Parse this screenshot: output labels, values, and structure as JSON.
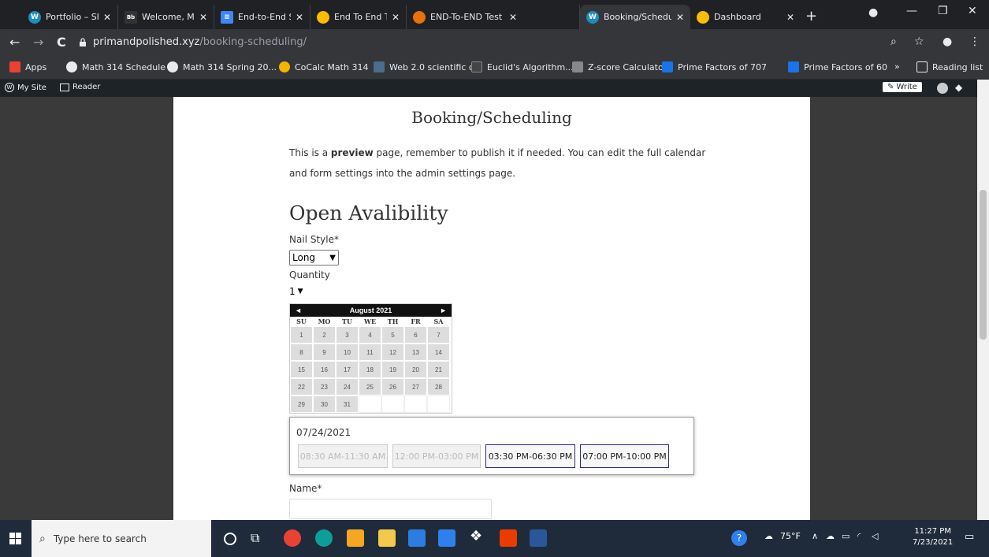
{
  "browser": {
    "tabs": [
      {
        "title": "Portfolio – Shawb",
        "color": "#1e8cbe",
        "glyph": "W"
      },
      {
        "title": "Welcome, Marcus",
        "color": "#333",
        "glyph": "Bb"
      },
      {
        "title": "End-to-End Syste",
        "color": "#4285f4",
        "glyph": "≡"
      },
      {
        "title": "End To End Testin",
        "color": "#fbbc04",
        "glyph": "●"
      },
      {
        "title": "END-To-END Test",
        "color": "#e8710a",
        "glyph": "●"
      },
      {
        "title": "Booking/Schedul",
        "color": "#1e8cbe",
        "glyph": "W"
      },
      {
        "title": "Dashboard",
        "color": "#fbbc04",
        "glyph": "●"
      }
    ],
    "url_host": "primandpolished.xyz",
    "url_path": "/booking-scheduling/",
    "bookmarks": [
      {
        "label": "Apps",
        "color": "#e94235"
      },
      {
        "label": "Math 314 Schedule",
        "color": "#e8eaed"
      },
      {
        "label": "Math 314 Spring 20...",
        "color": "#e8eaed"
      },
      {
        "label": "CoCalc Math 314",
        "color": "#f2b400"
      },
      {
        "label": "Web 2.0 scientific c...",
        "color": "#4a6d8c"
      },
      {
        "label": "Euclid's Algorithm...",
        "color": "#444"
      },
      {
        "label": "Z-score Calculator",
        "color": "#888"
      },
      {
        "label": "Prime Factors of 707",
        "color": "#1a73e8"
      },
      {
        "label": "Prime Factors of 60",
        "color": "#1a73e8"
      },
      {
        "label": "»",
        "color": ""
      },
      {
        "label": "Reading list",
        "color": "#e8eaed"
      }
    ]
  },
  "wpbar": {
    "my_site": "My Site",
    "reader": "Reader",
    "write": "Write"
  },
  "page": {
    "title": "Booking/Scheduling",
    "intro_pre": "This is a ",
    "intro_bold": "preview",
    "intro_post": " page, remember to publish it if needed. You can edit the full calendar and form settings into the admin settings page.",
    "heading": "Open Avalibility",
    "nail_style_label": "Nail Style*",
    "nail_style_value": "Long",
    "quantity_label": "Quantity",
    "quantity_value": "1",
    "name_label": "Name*"
  },
  "calendar": {
    "month": "August 2021",
    "prev": "◄",
    "next": "►",
    "dow": [
      "SU",
      "MO",
      "TU",
      "WE",
      "TH",
      "FR",
      "SA"
    ],
    "weeks": [
      [
        "1",
        "2",
        "3",
        "4",
        "5",
        "6",
        "7"
      ],
      [
        "8",
        "9",
        "10",
        "11",
        "12",
        "13",
        "14"
      ],
      [
        "15",
        "16",
        "17",
        "18",
        "19",
        "20",
        "21"
      ],
      [
        "22",
        "23",
        "24",
        "25",
        "26",
        "27",
        "28"
      ],
      [
        "29",
        "30",
        "31",
        "",
        "",
        "",
        ""
      ]
    ]
  },
  "slots": {
    "date": "07/24/2021",
    "items": [
      {
        "label": "08:30 AM-11:30 AM",
        "available": false
      },
      {
        "label": "12:00 PM-03:00 PM",
        "available": false
      },
      {
        "label": "03:30 PM-06:30 PM",
        "available": true
      },
      {
        "label": "07:00 PM-10:00 PM",
        "available": true
      }
    ]
  },
  "taskbar": {
    "search_placeholder": "Type here to search",
    "weather": "75°F",
    "time": "11:27 PM",
    "date": "7/23/2021"
  }
}
